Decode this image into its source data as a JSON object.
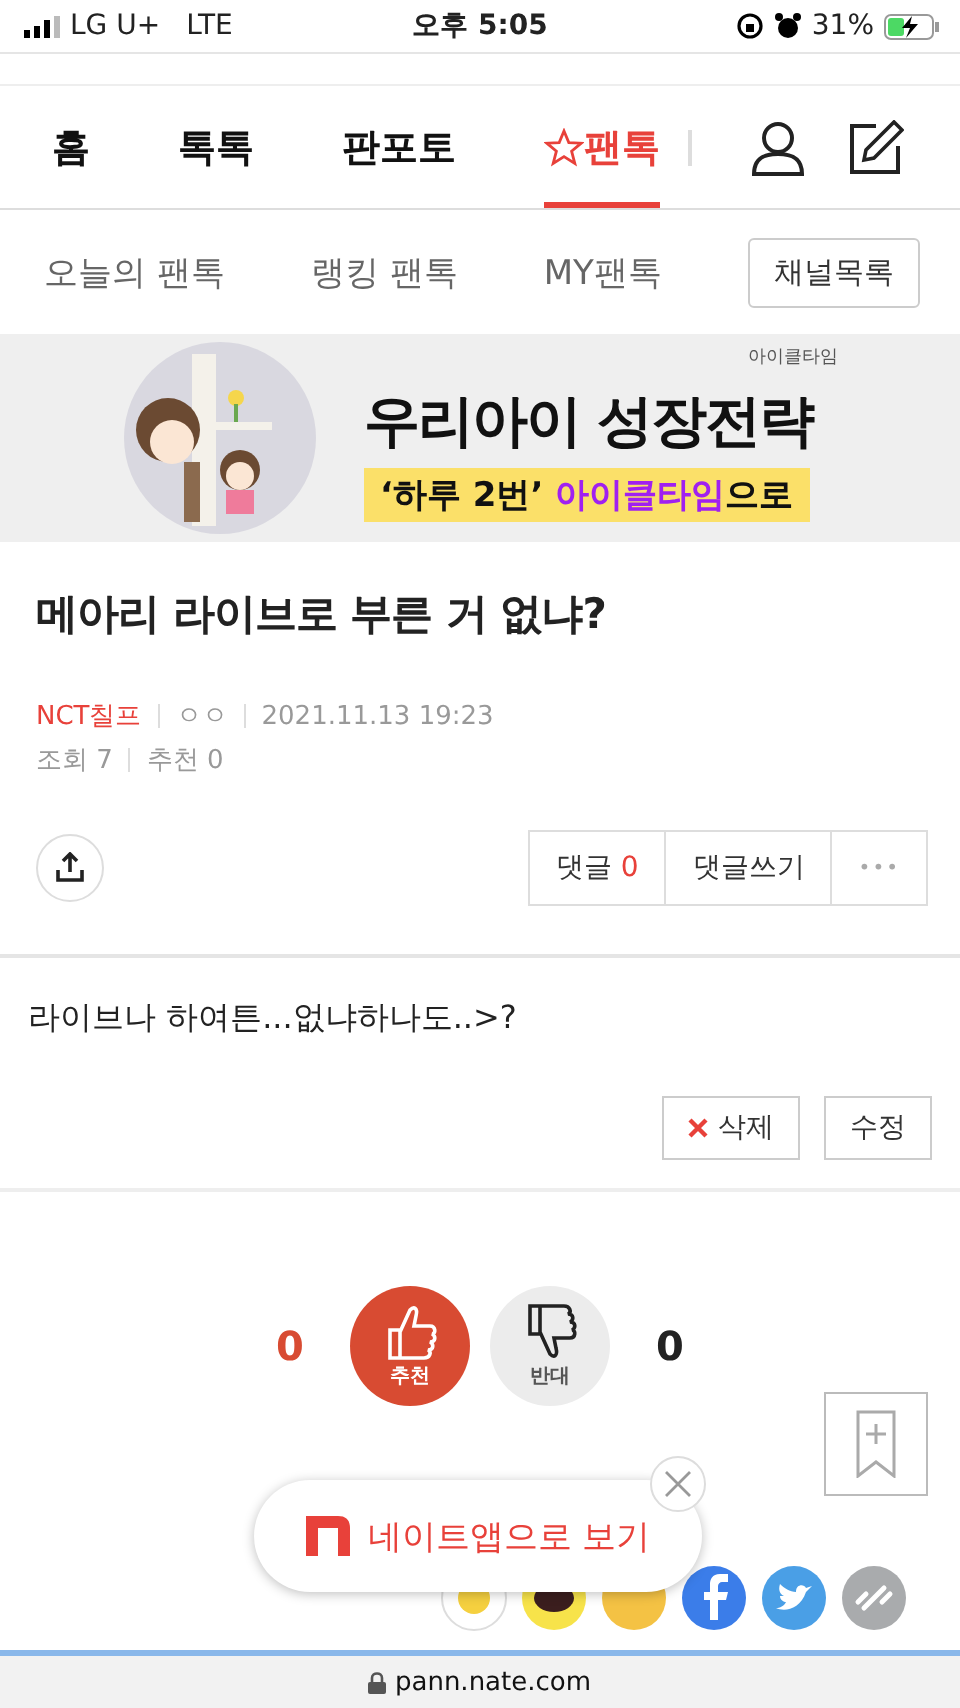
{
  "status_bar": {
    "carrier": "LG U+",
    "network": "LTE",
    "time": "오후 5:05",
    "battery": "31%",
    "charging": true
  },
  "nav": {
    "tabs": [
      {
        "label": "홈",
        "selected": false,
        "star": false
      },
      {
        "label": "톡톡",
        "selected": false,
        "star": false
      },
      {
        "label": "판포토",
        "selected": false,
        "star": false
      },
      {
        "label": "팬톡",
        "selected": true,
        "star": true
      }
    ]
  },
  "subnav": {
    "links": [
      "오늘의 팬톡",
      "랭킹 팬톡",
      "MY팬톡"
    ],
    "button": "채널목록"
  },
  "banner": {
    "brand": "아이클타임",
    "headline": "우리아이 성장전략",
    "tagline_prefix": "‘하루 2번’ ",
    "tagline_highlight": "아이클타임",
    "tagline_suffix": "으로"
  },
  "post": {
    "title": "메아리 라이브로 부른 거 없냐?",
    "author": "NCT칠프",
    "nickname": "ㅇㅇ",
    "date": "2021.11.13 19:23",
    "views_label": "조회",
    "views": "7",
    "likes_label": "추천",
    "likes": "0",
    "comments_label": "댓글",
    "comments": "0",
    "write_comment": "댓글쓰기",
    "more": "•••",
    "body": "라이브나 하여튼...없냐하나도..>?",
    "delete": "삭제",
    "edit": "수정"
  },
  "vote": {
    "up_count": "0",
    "up_label": "추천",
    "down_label": "반대",
    "down_count": "0"
  },
  "app_banner": {
    "label": "네이트앱으로 보기"
  },
  "address_bar": {
    "url": "pann.nate.com"
  }
}
